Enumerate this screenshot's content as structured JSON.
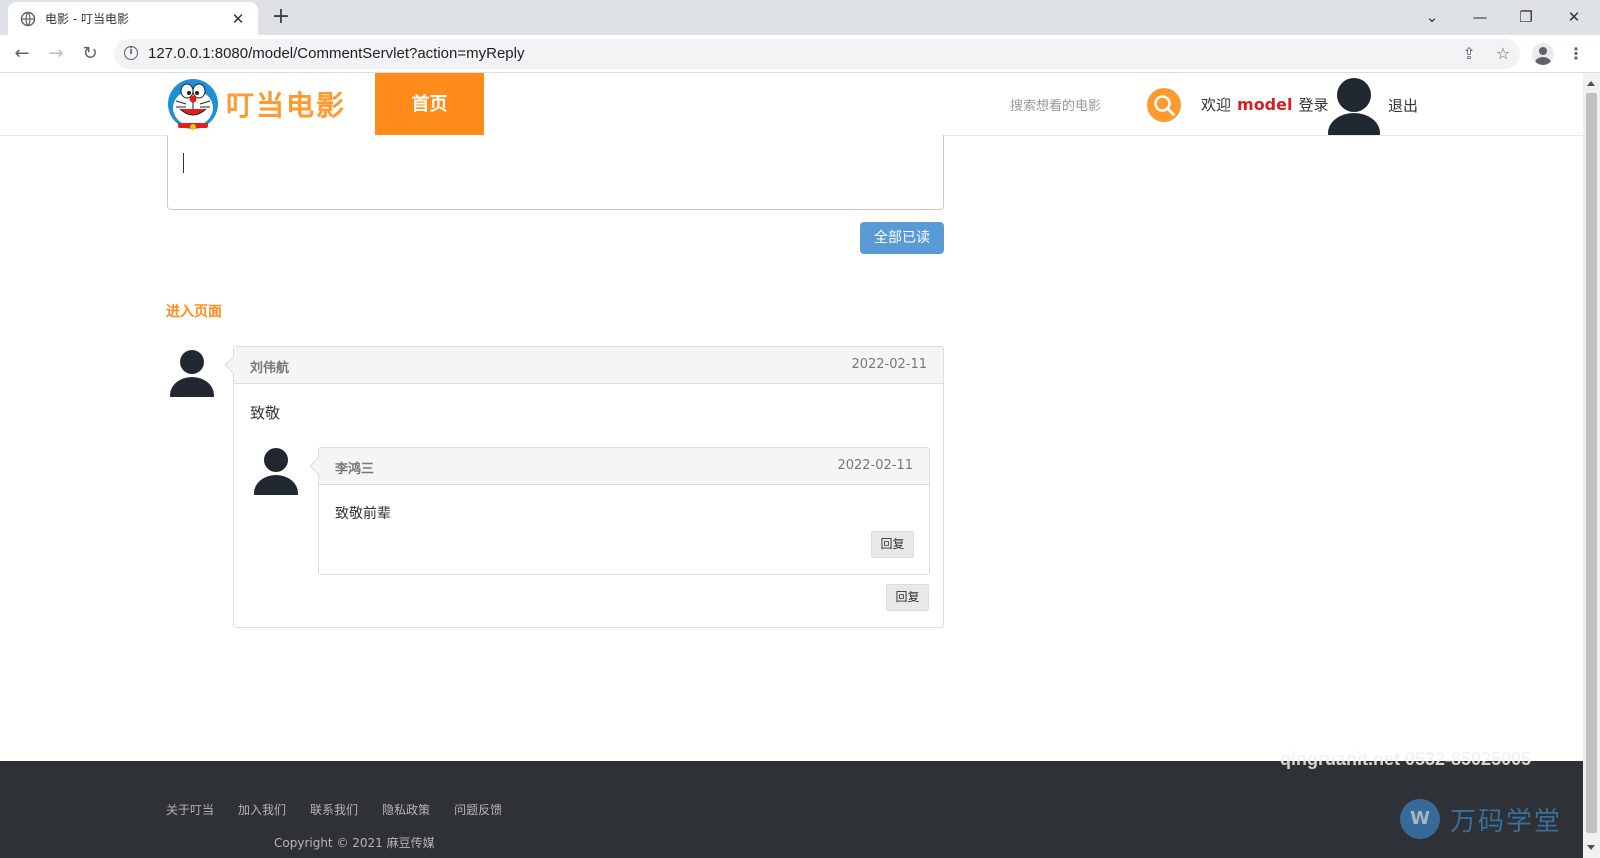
{
  "browser": {
    "tab_title": "电影 - 叮当电影",
    "url": "127.0.0.1:8080/model/CommentServlet?action=myReply"
  },
  "header": {
    "logo_text": "叮当电影",
    "home_label": "首页",
    "search_placeholder": "搜索想看的电影",
    "welcome_label": "欢迎",
    "username": "model",
    "login_label": "登录",
    "logout_label": "退出",
    "accent_color": "#ff8c1a"
  },
  "reply_form": {
    "read_all_label": "全部已读"
  },
  "enter_page_label": "进入页面",
  "comment": {
    "author": "刘伟航",
    "date": "2022-02-11",
    "text": "致敬",
    "reply_label": "回复",
    "reply": {
      "author": "李鸿三",
      "date": "2022-02-11",
      "text": "致敬前辈",
      "reply_label": "回复"
    }
  },
  "footer": {
    "links": [
      "关于叮当",
      "加入我们",
      "联系我们",
      "隐私政策",
      "问题反馈"
    ],
    "copyright": "Copyright © 2021 麻豆传媒",
    "watermark": "qingruanit.net 0532-85025005",
    "watermark_brand": "万码学堂"
  }
}
